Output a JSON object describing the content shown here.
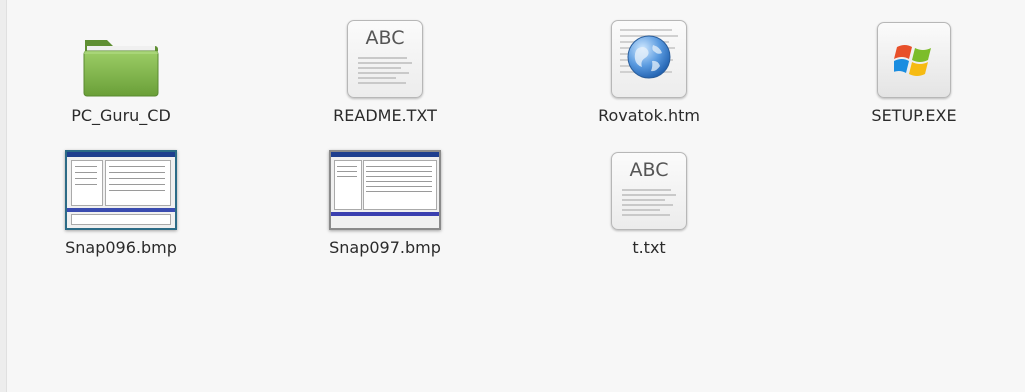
{
  "files": [
    {
      "name": "PC_Guru_CD",
      "type": "folder",
      "icon": "folder-icon"
    },
    {
      "name": "README.TXT",
      "type": "text",
      "icon": "text-file-icon",
      "glyph": "ABC"
    },
    {
      "name": "Rovatok.htm",
      "type": "html",
      "icon": "html-file-icon"
    },
    {
      "name": "SETUP.EXE",
      "type": "executable",
      "icon": "windows-exe-icon"
    },
    {
      "name": "Snap096.bmp",
      "type": "image",
      "icon": "bmp-thumbnail-icon"
    },
    {
      "name": "Snap097.bmp",
      "type": "image",
      "icon": "bmp-thumbnail-icon"
    },
    {
      "name": "t.txt",
      "type": "text",
      "icon": "text-file-icon",
      "glyph": "ABC"
    }
  ],
  "colors": {
    "folder": "#7fb24a",
    "background": "#f7f7f7",
    "thumbnail_border": "#2c6b86"
  }
}
